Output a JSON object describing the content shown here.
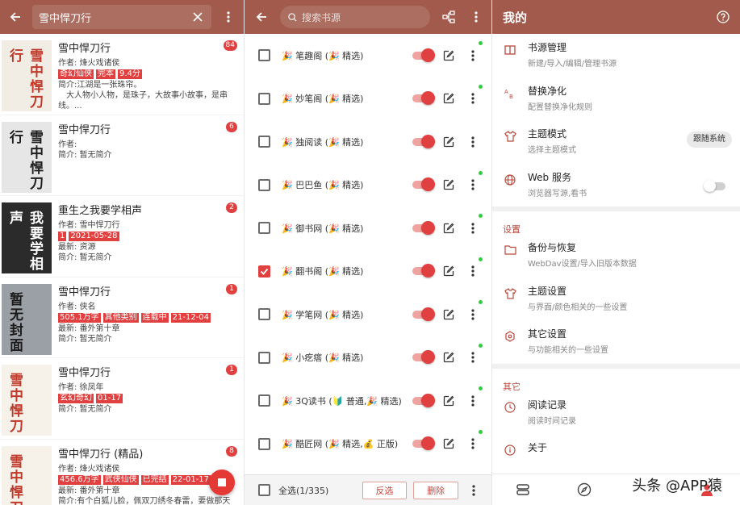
{
  "panel_books": {
    "search_value": "雪中悍刀行",
    "books": [
      {
        "cover_title": "雪中悍刀行",
        "name": "雪中悍刀行",
        "author": "作者: 烽火戏诸侯",
        "tags": [
          "奇幻仙侠",
          "完本",
          "9.4分"
        ],
        "line1": "简介:江湖是一张珠帘。",
        "line2": "　大人物小人物，是珠子，大故事小故事，是串",
        "line3": "线。...",
        "badge": "84"
      },
      {
        "cover_title": "雪中悍刀行",
        "name": "雪中悍刀行",
        "author": "作者:",
        "tags": [],
        "line1": "简介: 暂无简介",
        "line2": "",
        "line3": "",
        "badge": "6"
      },
      {
        "cover_title": "我要学相声",
        "name": "重生之我要学相声",
        "author": "作者: 雪中悍刀行",
        "tags": [
          "1",
          "2021-05-28"
        ],
        "line1": "最新: 资源",
        "line2": "简介: 暂无简介",
        "line3": "",
        "badge": "2"
      },
      {
        "cover_title": "暂无封面",
        "name": "雪中悍刀行",
        "author": "作者: 侠名",
        "tags": [
          "505.1万字",
          "其他类别",
          "连载中",
          "21-12-04"
        ],
        "line1": "最新: 番外第十章",
        "line2": "简介: 暂无简介",
        "line3": "",
        "badge": "1"
      },
      {
        "cover_title": "雪中悍刀",
        "name": "雪中悍刀行",
        "author": "作者: 徐凤年",
        "tags": [
          "玄幻奇幻",
          "01-17"
        ],
        "line1": "简介: 暂无简介",
        "line2": "",
        "line3": "",
        "badge": "1"
      },
      {
        "cover_title": "雪中悍刀",
        "name": "雪中悍刀行 (精品)",
        "author": "作者: 烽火戏诸侯",
        "tags": [
          "456.6万字",
          "武侠仙侠",
          "已完结",
          "22-01-17"
        ],
        "line1": "最新: 番外第十章",
        "line2": "简介:有个白狐儿脸，佩双刀绣冬春雷，要做那天",
        "line3": "",
        "badge": "8"
      }
    ]
  },
  "panel_sources": {
    "search_placeholder": "搜索书源",
    "sources": [
      {
        "name": "🎉 笔趣阁 (🎉 精选)",
        "checked": false,
        "dot": true
      },
      {
        "name": "🎉 妙笔阁 (🎉 精选)",
        "checked": false,
        "dot": true
      },
      {
        "name": "🎉 独阅读 (🎉 精选)",
        "checked": false,
        "dot": false
      },
      {
        "name": "🎉 巴巴鱼 (🎉 精选)",
        "checked": false,
        "dot": true
      },
      {
        "name": "🎉 御书网 (🎉 精选)",
        "checked": false,
        "dot": true
      },
      {
        "name": "🎉 翻书阁 (🎉 精选)",
        "checked": true,
        "dot": true
      },
      {
        "name": "🎉 学笔网 (🎉 精选)",
        "checked": false,
        "dot": true
      },
      {
        "name": "🎉 小疙瘩 (🎉 精选)",
        "checked": false,
        "dot": true
      },
      {
        "name": "🎉 3Q读书 (🔰 普通,🎉 精选)",
        "checked": false,
        "dot": true
      },
      {
        "name": "🎉 酷匠网 (🎉 精选,💰 正版)",
        "checked": false,
        "dot": true
      }
    ],
    "select_all_label": "全选(1/335)",
    "invert_label": "反选",
    "delete_label": "删除"
  },
  "panel_mine": {
    "title": "我的",
    "items_top": [
      {
        "title": "书源管理",
        "sub": "新建/导入/编辑/管理书源",
        "icon": "book-icon"
      },
      {
        "title": "替换净化",
        "sub": "配置替换净化规则",
        "icon": "replace-icon"
      },
      {
        "title": "主题模式",
        "sub": "选择主题模式",
        "icon": "shirt-icon",
        "chip": "跟随系统"
      },
      {
        "title": "Web 服务",
        "sub": "浏览器写源,看书",
        "icon": "globe-icon"
      }
    ],
    "section_settings": "设置",
    "items_settings": [
      {
        "title": "备份与恢复",
        "sub": "WebDav设置/导入旧版本数据",
        "icon": "folder-icon"
      },
      {
        "title": "主题设置",
        "sub": "与界面/颜色相关的一些设置",
        "icon": "shirt-icon"
      },
      {
        "title": "其它设置",
        "sub": "与功能相关的一些设置",
        "icon": "settings-icon"
      }
    ],
    "section_other": "其它",
    "items_other": [
      {
        "title": "阅读记录",
        "sub": "阅读时间记录",
        "icon": "clock-icon"
      },
      {
        "title": "关于",
        "sub": "",
        "icon": "info-icon"
      }
    ],
    "watermark": "头条 @APP猿"
  },
  "colors": {
    "topbar": "#a15a4b",
    "accent": "#e0403f",
    "online_dot": "#2fce3b"
  }
}
